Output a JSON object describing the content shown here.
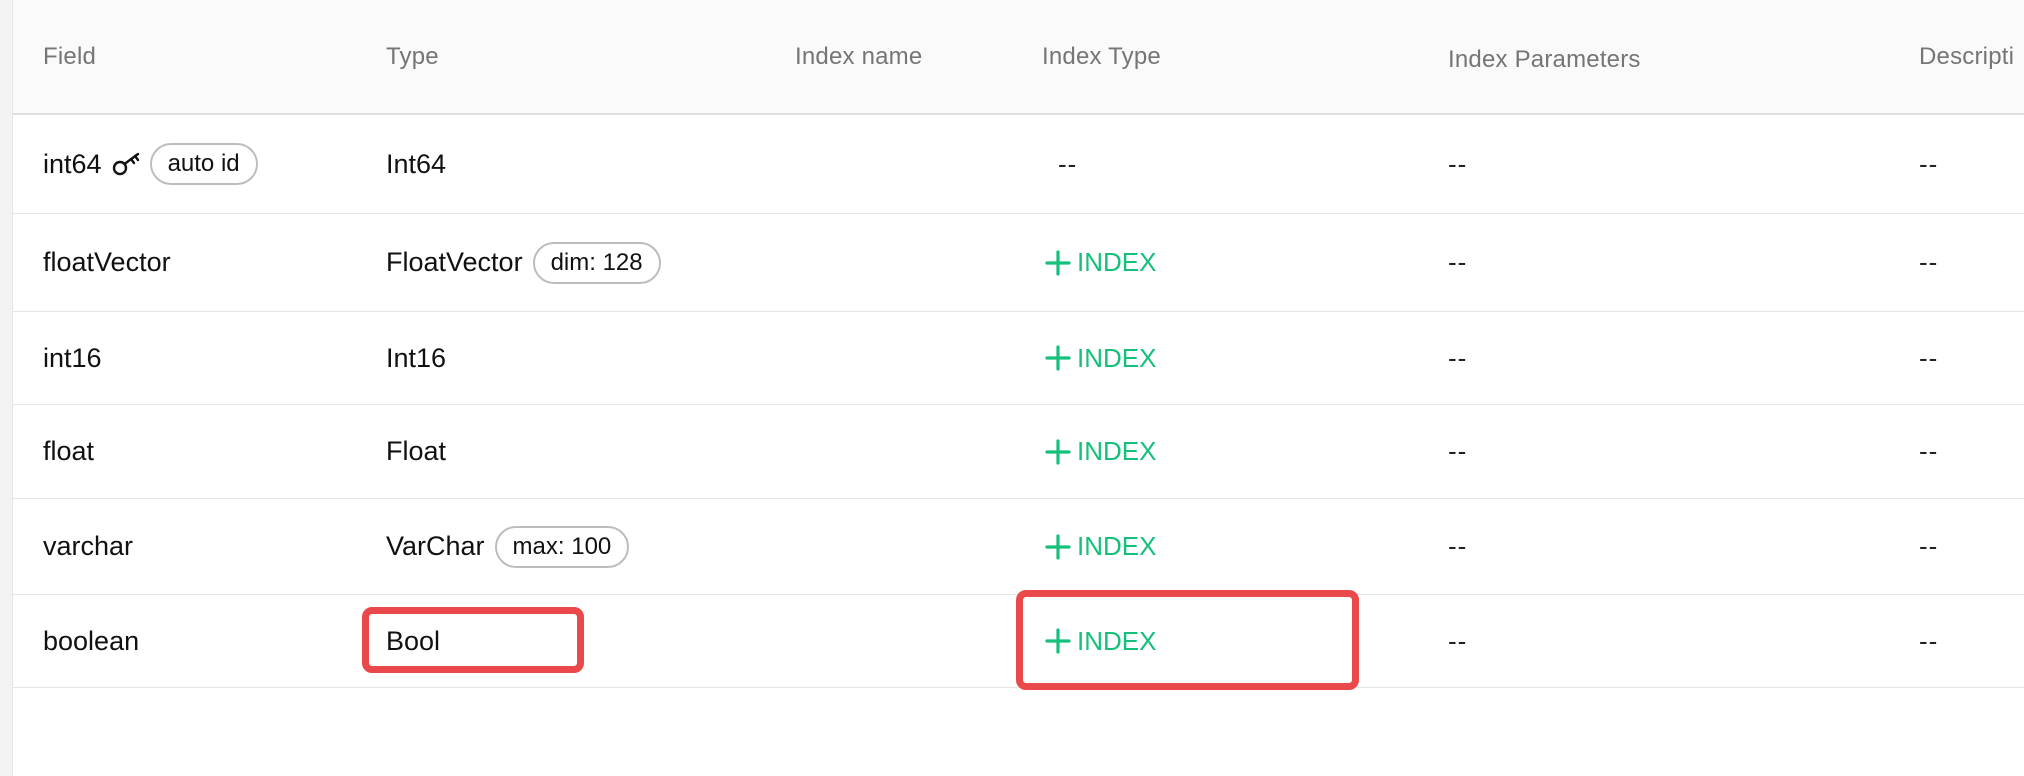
{
  "table": {
    "columns": [
      "Field",
      "Type",
      "Index name",
      "Index Type",
      "Index Parameters",
      "Descripti"
    ],
    "rows": [
      {
        "field": "int64",
        "field_chip": "auto id",
        "type": "Int64",
        "type_chip": "",
        "index_type": "--",
        "index_params": "--",
        "description": "--"
      },
      {
        "field": "floatVector",
        "field_chip": "",
        "type": "FloatVector",
        "type_chip": "dim: 128",
        "index_action": "INDEX",
        "index_params": "--",
        "description": "--"
      },
      {
        "field": "int16",
        "field_chip": "",
        "type": "Int16",
        "type_chip": "",
        "index_action": "INDEX",
        "index_params": "--",
        "description": "--"
      },
      {
        "field": "float",
        "field_chip": "",
        "type": "Float",
        "type_chip": "",
        "index_action": "INDEX",
        "index_params": "--",
        "description": "--"
      },
      {
        "field": "varchar",
        "field_chip": "",
        "type": "VarChar",
        "type_chip": "max: 100",
        "index_action": "INDEX",
        "index_params": "--",
        "description": "--"
      },
      {
        "field": "boolean",
        "field_chip": "",
        "type": "Bool",
        "type_chip": "",
        "index_action": "INDEX",
        "index_params": "--",
        "description": "--"
      }
    ]
  },
  "colors": {
    "accent_green": "#14c07a",
    "highlight_red": "#e9494a"
  },
  "icons": {
    "primary_key": "key-icon",
    "add": "plus-icon"
  }
}
